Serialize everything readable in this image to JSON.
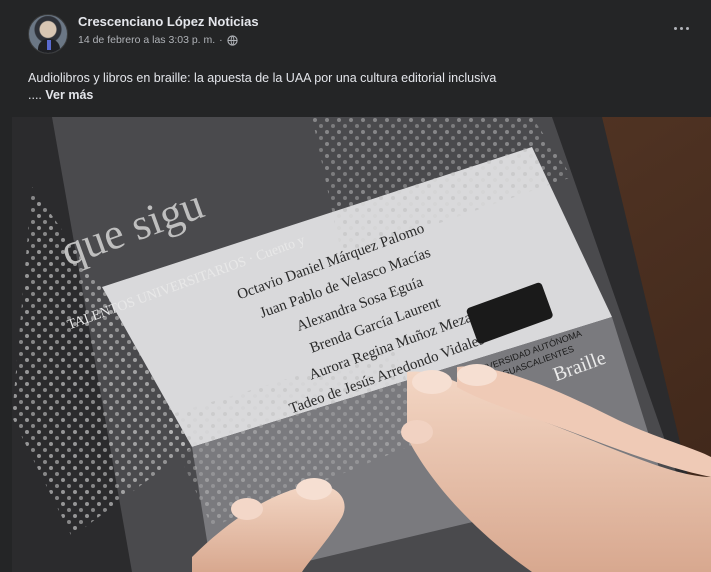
{
  "post": {
    "author": "Crescenciano López Noticias",
    "date": "14 de febrero a las 3:03 p. m.",
    "separator": "·",
    "text_line1": "Audiolibros y libros en braille: la apuesta de la UAA por una cultura editorial inclusiva",
    "ellipsis": "....",
    "see_more": "Ver más",
    "more_icon": "more-horizontal-icon",
    "privacy_icon": "globe-icon"
  },
  "photo": {
    "cover_title_fragment": "que sigu",
    "series_line": "TALENTOS UNIVERSITARIOS · Cuento y",
    "authors": [
      "Octavio Daniel Márquez Palomo",
      "Juan Pablo de Velasco Macías",
      "Alexandra Sosa Eguía",
      "Brenda García Laurent",
      "Aurora Regina Muñoz Meza",
      "Tadeo de Jesús Arredondo Vidales"
    ],
    "university": "UNIVERSIDAD AUTÓNOMA",
    "university_line2": "DE AGUASCALIENTES",
    "braille_label": "Braille"
  }
}
